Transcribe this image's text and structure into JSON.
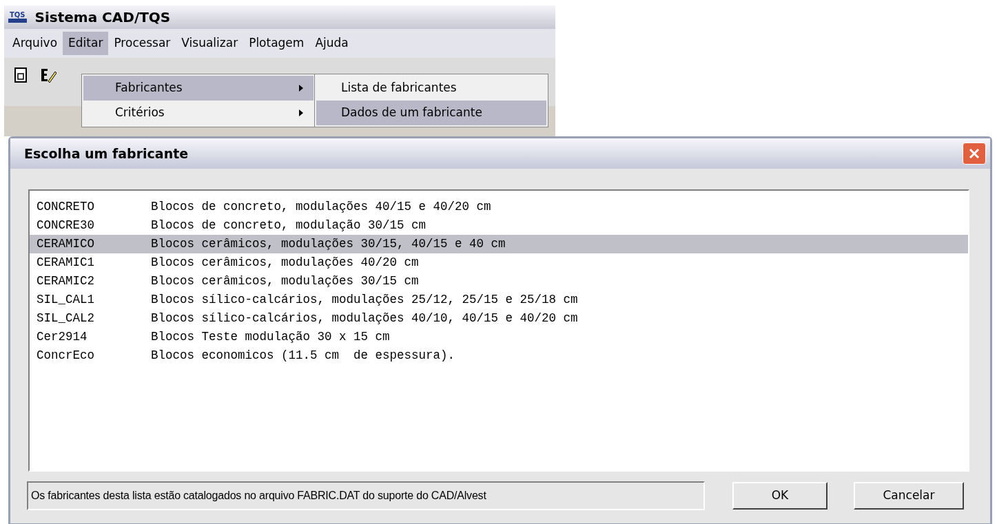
{
  "app_window": {
    "title": "Sistema CAD/TQS",
    "logo": "TQS"
  },
  "menu_bar": [
    {
      "label": "Arquivo",
      "selected": false
    },
    {
      "label": "Editar",
      "selected": true
    },
    {
      "label": "Processar",
      "selected": false
    },
    {
      "label": "Visualizar",
      "selected": false
    },
    {
      "label": "Plotagem",
      "selected": false
    },
    {
      "label": "Ajuda",
      "selected": false
    }
  ],
  "edit_menu": [
    {
      "label": "Fabricantes",
      "selected": true,
      "has_submenu": true
    },
    {
      "label": "Critérios",
      "selected": false,
      "has_submenu": true
    }
  ],
  "submenu": [
    {
      "label": "Lista de fabricantes",
      "selected": false
    },
    {
      "label": "Dados de um fabricante",
      "selected": true
    }
  ],
  "dialog": {
    "title": "Escolha um fabricante",
    "list": [
      {
        "code": "CONCRETO",
        "description": "Blocos de concreto, modulações 40/15 e 40/20 cm",
        "selected": false
      },
      {
        "code": "CONCRE30",
        "description": "Blocos de concreto, modulação 30/15 cm",
        "selected": false
      },
      {
        "code": "CERAMICO",
        "description": "Blocos cerâmicos, modulações 30/15, 40/15 e 40 cm",
        "selected": true
      },
      {
        "code": "CERAMIC1",
        "description": "Blocos cerâmicos, modulações 40/20 cm",
        "selected": false
      },
      {
        "code": "CERAMIC2",
        "description": "Blocos cerâmicos, modulações 30/15 cm",
        "selected": false
      },
      {
        "code": "SIL_CAL1",
        "description": "Blocos sílico-calcários, modulações 25/12, 25/15 e 25/18 cm",
        "selected": false
      },
      {
        "code": "SIL_CAL2",
        "description": "Blocos sílico-calcários, modulações 40/10, 40/15 e 40/20 cm",
        "selected": false
      },
      {
        "code": "Cer2914",
        "description": "Blocos Teste modulação 30 x 15 cm",
        "selected": false
      },
      {
        "code": "ConcrEco",
        "description": "Blocos economicos (11.5 cm  de espessura).",
        "selected": false
      }
    ],
    "status": "Os fabricantes desta lista estão catalogados no arquivo FABRIC.DAT do suporte do CAD/Alvest",
    "buttons": [
      {
        "label": "OK"
      },
      {
        "label": "Cancelar"
      }
    ]
  }
}
